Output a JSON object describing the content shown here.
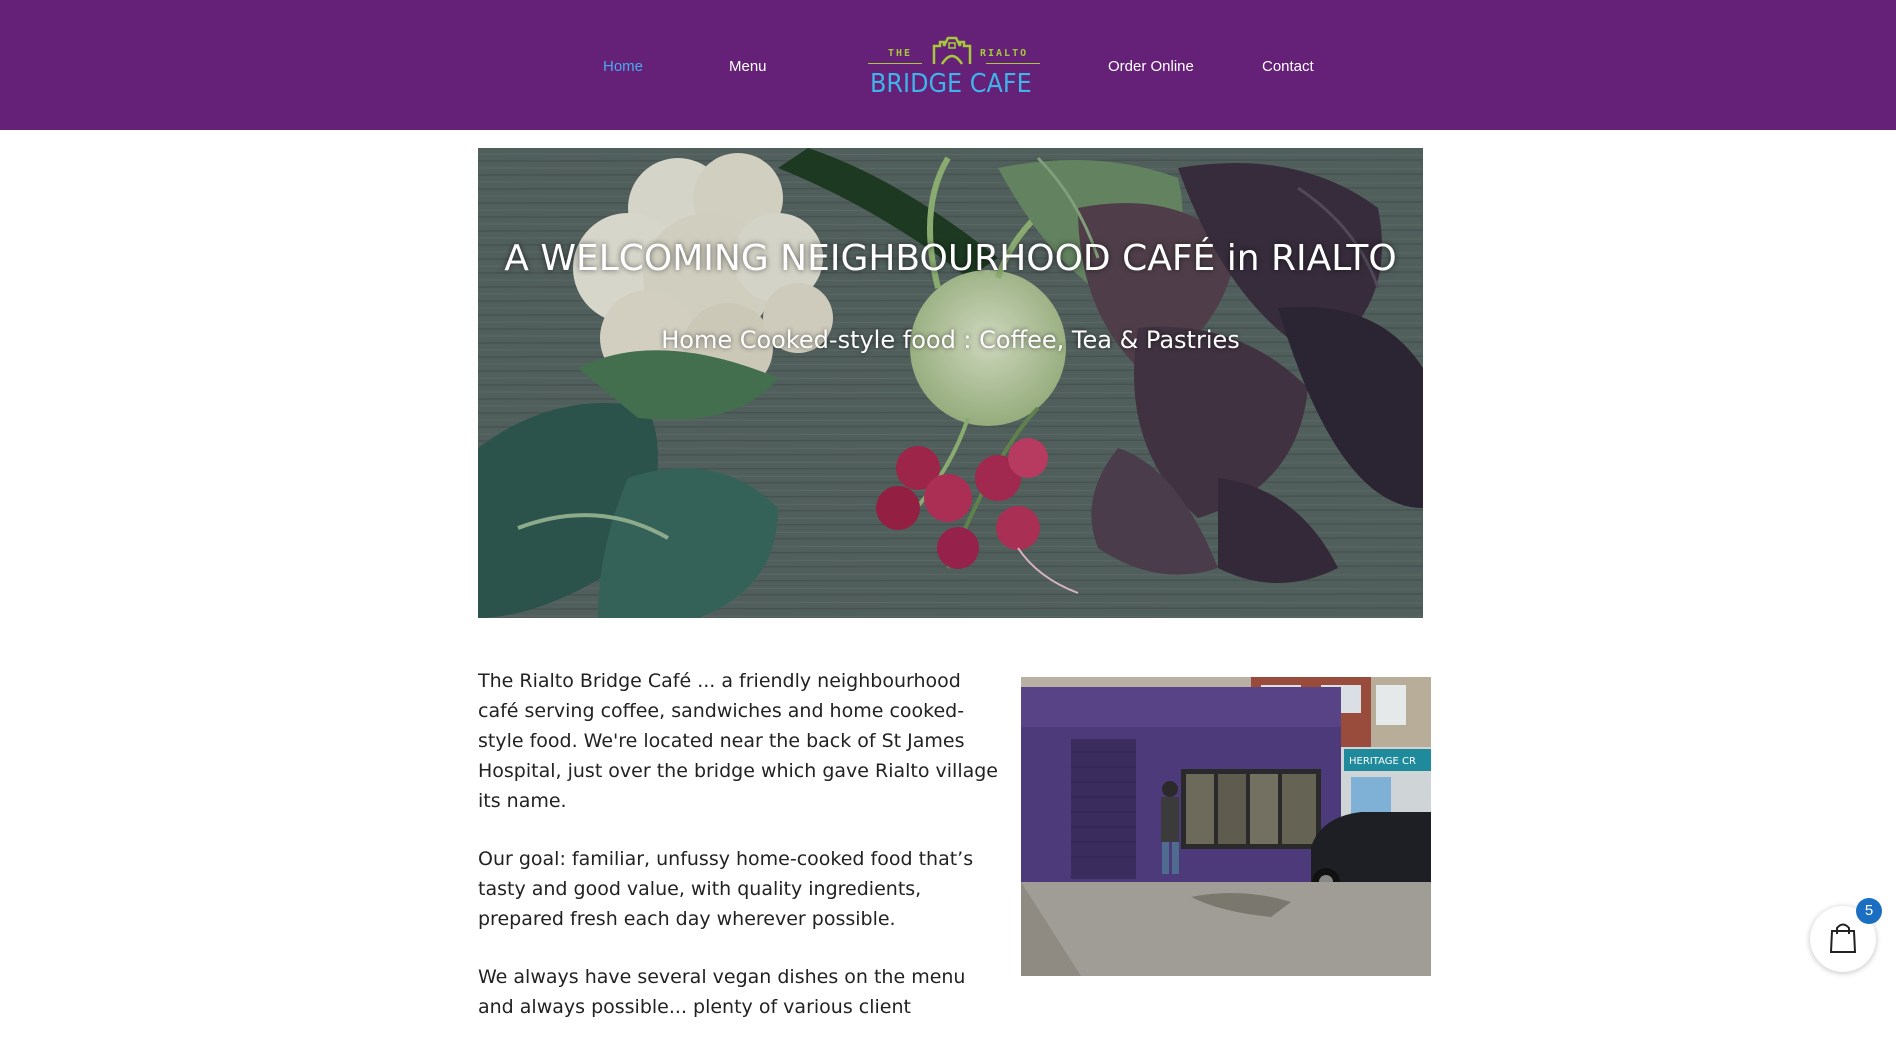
{
  "nav": {
    "items": [
      {
        "label": "Home",
        "active": true
      },
      {
        "label": "Menu",
        "active": false
      },
      {
        "label": "Order Online",
        "active": false
      },
      {
        "label": "Contact",
        "active": false
      }
    ]
  },
  "logo": {
    "small_left": "THE",
    "small_right": "RIALTO",
    "name": "BRIDGE CAFE",
    "colors": {
      "primary": "#3eb4ea",
      "accent": "#a6c93b"
    }
  },
  "hero": {
    "title": "A WELCOMING NEIGHBOURHOOD CAFÉ in RIALTO",
    "subtitle": "Home Cooked-style food : Coffee, Tea & Pastries"
  },
  "content": {
    "paragraphs": [
      "The Rialto Bridge Café ... a friendly neighbourhood café serving coffee, sandwiches and home cooked-style food. We're located near the back of St James Hospital, just over the bridge which gave Rialto village its name.",
      "Our goal: familiar, unfussy home-cooked food that’s tasty and good value, with quality ingredients, prepared fresh each day wherever possible.",
      "We always have several vegan dishes on the menu and always possible... plenty of various client"
    ]
  },
  "photo": {
    "shop_sign": "HERITAGE CR"
  },
  "cart": {
    "count": "5"
  },
  "theme": {
    "header_bg": "#652077",
    "nav_active": "#4aa8f0"
  }
}
